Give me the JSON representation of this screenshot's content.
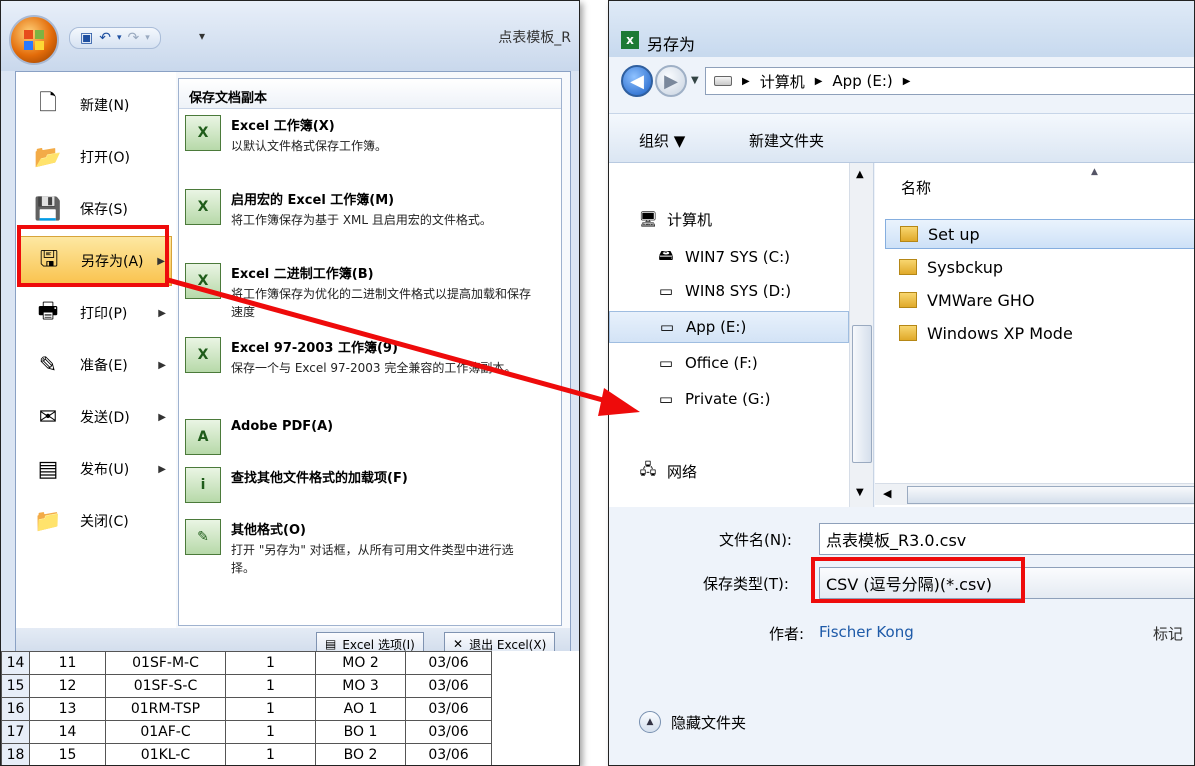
{
  "excel": {
    "doc_title": "点表模板_R",
    "menu_items": [
      {
        "label": "新建(N)",
        "icon": "new-doc-icon",
        "has_arrow": false
      },
      {
        "label": "打开(O)",
        "icon": "folder-open-icon",
        "has_arrow": false
      },
      {
        "label": "保存(S)",
        "icon": "save-icon",
        "has_arrow": false
      },
      {
        "label": "另存为(A)",
        "icon": "save-as-icon",
        "has_arrow": true,
        "active": true
      },
      {
        "label": "打印(P)",
        "icon": "print-icon",
        "has_arrow": true
      },
      {
        "label": "准备(E)",
        "icon": "prepare-icon",
        "has_arrow": true
      },
      {
        "label": "发送(D)",
        "icon": "send-icon",
        "has_arrow": true
      },
      {
        "label": "发布(U)",
        "icon": "publish-icon",
        "has_arrow": true
      },
      {
        "label": "关闭(C)",
        "icon": "close-doc-icon",
        "has_arrow": false
      }
    ],
    "submenu_header": "保存文档副本",
    "submenu_items": [
      {
        "title": "Excel 工作簿(X)",
        "desc": "以默认文件格式保存工作簿。",
        "icon": "excel-workbook-icon"
      },
      {
        "title": "启用宏的 Excel 工作簿(M)",
        "desc": "将工作簿保存为基于 XML 且启用宏的文件格式。",
        "icon": "excel-macro-icon"
      },
      {
        "title": "Excel 二进制工作簿(B)",
        "desc": "将工作簿保存为优化的二进制文件格式以提高加载和保存速度",
        "icon": "excel-binary-icon"
      },
      {
        "title": "Excel 97-2003 工作簿(9)",
        "desc": "保存一个与 Excel 97-2003 完全兼容的工作簿副本。",
        "icon": "excel-97-icon"
      },
      {
        "title": "Adobe PDF(A)",
        "desc": "",
        "icon": "adobe-pdf-icon"
      },
      {
        "title": "查找其他文件格式的加载项(F)",
        "desc": "",
        "icon": "find-addins-icon"
      },
      {
        "title": "其他格式(O)",
        "desc": "打开 \"另存为\" 对话框，从所有可用文件类型中进行选择。",
        "icon": "other-formats-icon"
      }
    ],
    "footer": {
      "options_label": "Excel 选项(I)",
      "exit_label": "退出 Excel(X)"
    },
    "sheet_rows": [
      [
        "14",
        "11",
        "01SF-M-C",
        "1",
        "MO 2",
        "03/06"
      ],
      [
        "15",
        "12",
        "01SF-S-C",
        "1",
        "MO 3",
        "03/06"
      ],
      [
        "16",
        "13",
        "01RM-TSP",
        "1",
        "AO 1",
        "03/06"
      ],
      [
        "17",
        "14",
        "01AF-C",
        "1",
        "BO 1",
        "03/06"
      ],
      [
        "18",
        "15",
        "01KL-C",
        "1",
        "BO 2",
        "03/06"
      ]
    ]
  },
  "dialog": {
    "title": "另存为",
    "breadcrumb": [
      "计算机",
      "App (E:)"
    ],
    "toolbar": {
      "organize": "组织 ▼",
      "new_folder": "新建文件夹"
    },
    "nav": [
      {
        "label": "计算机",
        "icon": "computer-icon",
        "indent": 0
      },
      {
        "label": "WIN7 SYS (C:)",
        "icon": "drive-os-icon",
        "indent": 1
      },
      {
        "label": "WIN8 SYS (D:)",
        "icon": "drive-icon",
        "indent": 1
      },
      {
        "label": "App (E:)",
        "icon": "drive-icon",
        "indent": 1,
        "selected": true
      },
      {
        "label": "Office (F:)",
        "icon": "drive-icon",
        "indent": 1
      },
      {
        "label": "Private (G:)",
        "icon": "drive-icon",
        "indent": 1
      },
      {
        "label": "网络",
        "icon": "network-icon",
        "indent": 0
      }
    ],
    "column_name": "名称",
    "files": [
      {
        "name": "Set up",
        "selected": true
      },
      {
        "name": "Sysbckup"
      },
      {
        "name": "VMWare GHO"
      },
      {
        "name": "Windows XP Mode"
      }
    ],
    "filename_label": "文件名(N):",
    "filename_value": "点表模板_R3.0.csv",
    "filetype_label": "保存类型(T):",
    "filetype_value": "CSV (逗号分隔)(*.csv)",
    "author_label": "作者:",
    "author_value": "Fischer Kong",
    "tags_label": "标记",
    "hide_folders": "隐藏文件夹"
  },
  "colors": {
    "highlight_red": "#ee0b0b",
    "active_menu": "#f9c24c"
  }
}
